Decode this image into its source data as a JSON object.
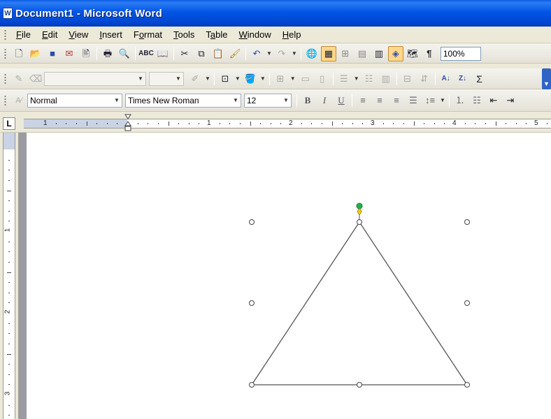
{
  "window": {
    "title": "Document1 - Microsoft Word"
  },
  "menu": [
    {
      "label": "File",
      "key": "F"
    },
    {
      "label": "Edit",
      "key": "E"
    },
    {
      "label": "View",
      "key": "V"
    },
    {
      "label": "Insert",
      "key": "I"
    },
    {
      "label": "Format",
      "key": "o"
    },
    {
      "label": "Tools",
      "key": "T"
    },
    {
      "label": "Table",
      "key": "a"
    },
    {
      "label": "Window",
      "key": "W"
    },
    {
      "label": "Help",
      "key": "H"
    }
  ],
  "standard_toolbar": {
    "zoom": "100%",
    "icons": [
      "new-icon",
      "open-icon",
      "save-icon",
      "permission-icon",
      "email-icon",
      "print-icon",
      "print-preview-icon",
      "spelling-icon",
      "research-icon",
      "cut-icon",
      "copy-icon",
      "paste-icon",
      "format-painter-icon",
      "undo-icon",
      "redo-icon",
      "hyperlink-icon",
      "tables-borders-icon",
      "insert-table-icon",
      "insert-excel-icon",
      "columns-icon",
      "drawing-icon",
      "document-map-icon",
      "show-hide-icon"
    ]
  },
  "formatting_toolbar": {
    "style": "Normal",
    "font": "Times New Roman",
    "size": "12"
  },
  "ruler": {
    "h_numbers": [
      "1",
      "1",
      "2",
      "3",
      "4",
      "5"
    ],
    "v_numbers": [
      "1",
      "2",
      "3"
    ]
  },
  "shape": {
    "type": "triangle",
    "stroke": "#555555",
    "rotation_handle_color": "#22b14c"
  },
  "colors": {
    "titlebar": "#0055e5",
    "toolbar_active": "#ffd889",
    "ruler_margin": "#c9d3e4"
  }
}
